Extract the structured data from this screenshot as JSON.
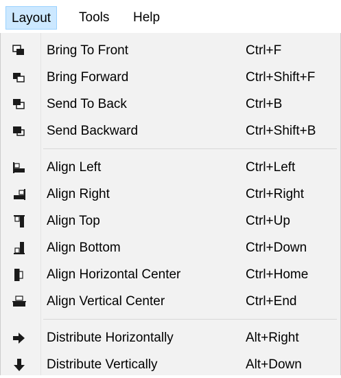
{
  "menubar": {
    "items": [
      {
        "label": "Layout",
        "active": true
      },
      {
        "label": "Tools"
      },
      {
        "label": "Help"
      }
    ]
  },
  "menu": {
    "groups": [
      {
        "items": [
          {
            "label": "Bring To Front",
            "shortcut": "Ctrl+F",
            "icon": "bring-to-front-icon"
          },
          {
            "label": "Bring Forward",
            "shortcut": "Ctrl+Shift+F",
            "icon": "bring-forward-icon"
          },
          {
            "label": "Send To Back",
            "shortcut": "Ctrl+B",
            "icon": "send-to-back-icon"
          },
          {
            "label": "Send Backward",
            "shortcut": "Ctrl+Shift+B",
            "icon": "send-backward-icon"
          }
        ]
      },
      {
        "items": [
          {
            "label": "Align Left",
            "shortcut": "Ctrl+Left",
            "icon": "align-left-icon"
          },
          {
            "label": "Align Right",
            "shortcut": "Ctrl+Right",
            "icon": "align-right-icon"
          },
          {
            "label": "Align Top",
            "shortcut": "Ctrl+Up",
            "icon": "align-top-icon"
          },
          {
            "label": "Align Bottom",
            "shortcut": "Ctrl+Down",
            "icon": "align-bottom-icon"
          },
          {
            "label": "Align Horizontal Center",
            "shortcut": "Ctrl+Home",
            "icon": "align-horizontal-center-icon"
          },
          {
            "label": "Align Vertical Center",
            "shortcut": "Ctrl+End",
            "icon": "align-vertical-center-icon"
          }
        ]
      },
      {
        "items": [
          {
            "label": "Distribute Horizontally",
            "shortcut": "Alt+Right",
            "icon": "arrow-right-icon"
          },
          {
            "label": "Distribute Vertically",
            "shortcut": "Alt+Down",
            "icon": "arrow-down-icon"
          }
        ]
      }
    ]
  },
  "colors": {
    "menu_background": "#f2f2f2",
    "active_menu_highlight": "#cce8ff",
    "active_menu_border": "#99d1ff",
    "icon": "#1a1a1a"
  }
}
